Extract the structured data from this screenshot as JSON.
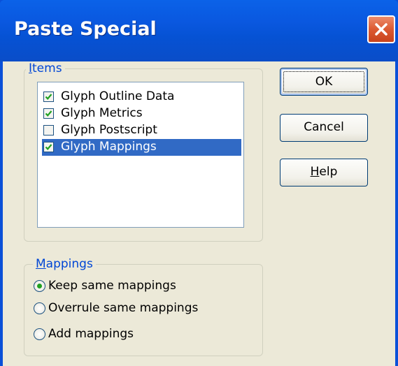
{
  "window": {
    "title": "Paste Special"
  },
  "items_group": {
    "legend_underline": "I",
    "legend_rest": "tems",
    "items": [
      {
        "label": "Glyph Outline Data",
        "checked": true,
        "selected": false
      },
      {
        "label": "Glyph Metrics",
        "checked": true,
        "selected": false
      },
      {
        "label": "Glyph Postscript",
        "checked": false,
        "selected": false
      },
      {
        "label": "Glyph Mappings",
        "checked": true,
        "selected": true
      }
    ]
  },
  "mappings_group": {
    "legend_underline": "M",
    "legend_rest": "appings",
    "options": [
      {
        "label": "Keep same mappings",
        "selected": true
      },
      {
        "label": "Overrule same mappings",
        "selected": false
      },
      {
        "label": "Add mappings",
        "selected": false
      }
    ]
  },
  "buttons": {
    "ok": "OK",
    "cancel": "Cancel",
    "help_underline": "H",
    "help_rest": "elp"
  },
  "colors": {
    "titlebar": "#0a58e0",
    "dialog_bg": "#ece9d8",
    "selection": "#316ac5",
    "group_legend": "#0046d5",
    "check_green": "#21a121",
    "close_red": "#dc5a32"
  }
}
